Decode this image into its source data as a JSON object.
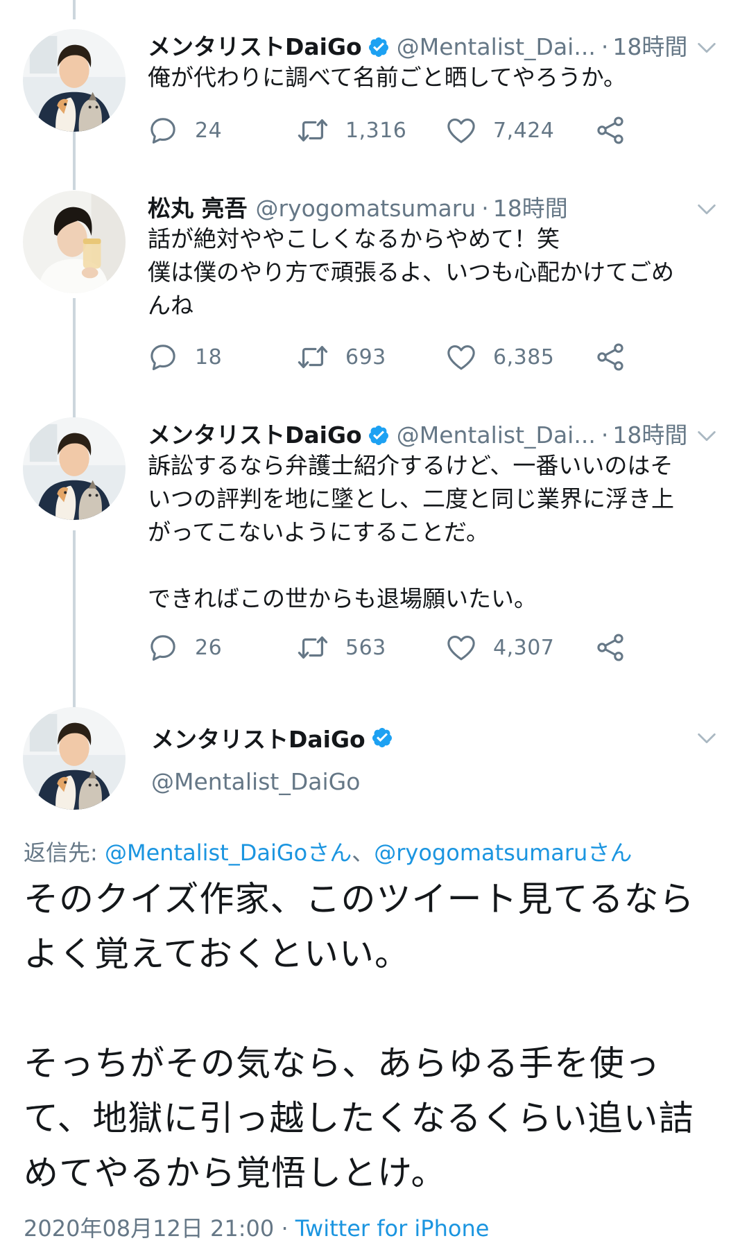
{
  "tweets": [
    {
      "name": "メンタリストDaiGo",
      "verified": true,
      "handle": "@Mentalist_Dai...",
      "dot": "·",
      "time": "18時間",
      "text": "俺が代わりに調べて名前ごと晒してやろうか。",
      "replies": "24",
      "retweets": "1,316",
      "likes": "7,424"
    },
    {
      "name": "松丸 亮吾",
      "verified": false,
      "handle": "@ryogomatsumaru",
      "dot": "·",
      "time": "18時間",
      "text": "話が絶対ややこしくなるからやめて！笑\n僕は僕のやり方で頑張るよ、いつも心配かけてごめ\nんね",
      "replies": "18",
      "retweets": "693",
      "likes": "6,385"
    },
    {
      "name": "メンタリストDaiGo",
      "verified": true,
      "handle": "@Mentalist_Dai...",
      "dot": "·",
      "time": "18時間",
      "text": "訴訟するなら弁護士紹介するけど、一番いいのはそ\nいつの評判を地に墜とし、二度と同じ業界に浮き上\nがってこないようにすることだ。\n\nできればこの世からも退場願いたい。",
      "replies": "26",
      "retweets": "563",
      "likes": "4,307"
    }
  ],
  "main_tweet": {
    "name": "メンタリストDaiGo",
    "verified": true,
    "handle": "@Mentalist_DaiGo",
    "reply_prefix": "返信先: ",
    "reply_user1": "@Mentalist_DaiGoさん",
    "reply_sep": "、",
    "reply_user2": "@ryogomatsumaruさん",
    "text": "そのクイズ作家、このツイート見てるなら\nよく覚えておくといい。\n\nそっちがその気なら、あらゆる手を使っ\nて、地獄に引っ越したくなるくらい追い詰\nめてやるから覚悟しとけ。",
    "timestamp": "2020年08月12日 21:00",
    "ts_sep": " · ",
    "source": "Twitter for iPhone"
  },
  "icons": {
    "reply": "reply-icon",
    "retweet": "retweet-icon",
    "like": "heart-icon",
    "share": "share-icon",
    "verified": "verified-badge-icon",
    "caret": "chevron-down-icon"
  },
  "colors": {
    "verified": "#1da1f2",
    "link": "#1b95e0",
    "secondary": "#657786",
    "thread_line": "#ccd6dd"
  }
}
